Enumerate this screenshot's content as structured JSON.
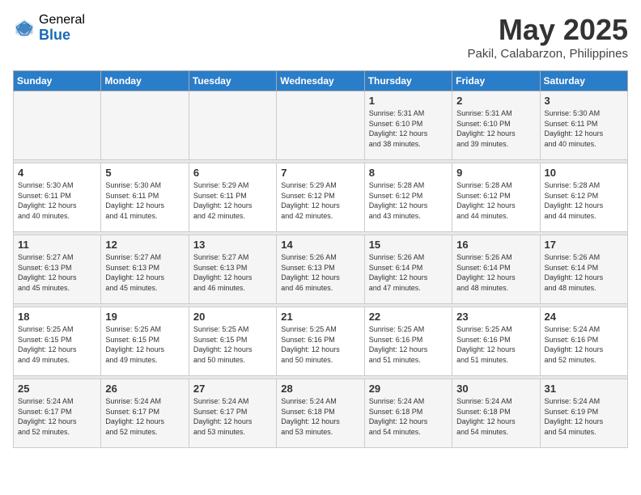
{
  "logo": {
    "general": "General",
    "blue": "Blue"
  },
  "title": "May 2025",
  "location": "Pakil, Calabarzon, Philippines",
  "days_of_week": [
    "Sunday",
    "Monday",
    "Tuesday",
    "Wednesday",
    "Thursday",
    "Friday",
    "Saturday"
  ],
  "weeks": [
    [
      {
        "day": "",
        "info": ""
      },
      {
        "day": "",
        "info": ""
      },
      {
        "day": "",
        "info": ""
      },
      {
        "day": "",
        "info": ""
      },
      {
        "day": "1",
        "info": "Sunrise: 5:31 AM\nSunset: 6:10 PM\nDaylight: 12 hours\nand 38 minutes."
      },
      {
        "day": "2",
        "info": "Sunrise: 5:31 AM\nSunset: 6:10 PM\nDaylight: 12 hours\nand 39 minutes."
      },
      {
        "day": "3",
        "info": "Sunrise: 5:30 AM\nSunset: 6:11 PM\nDaylight: 12 hours\nand 40 minutes."
      }
    ],
    [
      {
        "day": "4",
        "info": "Sunrise: 5:30 AM\nSunset: 6:11 PM\nDaylight: 12 hours\nand 40 minutes."
      },
      {
        "day": "5",
        "info": "Sunrise: 5:30 AM\nSunset: 6:11 PM\nDaylight: 12 hours\nand 41 minutes."
      },
      {
        "day": "6",
        "info": "Sunrise: 5:29 AM\nSunset: 6:11 PM\nDaylight: 12 hours\nand 42 minutes."
      },
      {
        "day": "7",
        "info": "Sunrise: 5:29 AM\nSunset: 6:12 PM\nDaylight: 12 hours\nand 42 minutes."
      },
      {
        "day": "8",
        "info": "Sunrise: 5:28 AM\nSunset: 6:12 PM\nDaylight: 12 hours\nand 43 minutes."
      },
      {
        "day": "9",
        "info": "Sunrise: 5:28 AM\nSunset: 6:12 PM\nDaylight: 12 hours\nand 44 minutes."
      },
      {
        "day": "10",
        "info": "Sunrise: 5:28 AM\nSunset: 6:12 PM\nDaylight: 12 hours\nand 44 minutes."
      }
    ],
    [
      {
        "day": "11",
        "info": "Sunrise: 5:27 AM\nSunset: 6:13 PM\nDaylight: 12 hours\nand 45 minutes."
      },
      {
        "day": "12",
        "info": "Sunrise: 5:27 AM\nSunset: 6:13 PM\nDaylight: 12 hours\nand 45 minutes."
      },
      {
        "day": "13",
        "info": "Sunrise: 5:27 AM\nSunset: 6:13 PM\nDaylight: 12 hours\nand 46 minutes."
      },
      {
        "day": "14",
        "info": "Sunrise: 5:26 AM\nSunset: 6:13 PM\nDaylight: 12 hours\nand 46 minutes."
      },
      {
        "day": "15",
        "info": "Sunrise: 5:26 AM\nSunset: 6:14 PM\nDaylight: 12 hours\nand 47 minutes."
      },
      {
        "day": "16",
        "info": "Sunrise: 5:26 AM\nSunset: 6:14 PM\nDaylight: 12 hours\nand 48 minutes."
      },
      {
        "day": "17",
        "info": "Sunrise: 5:26 AM\nSunset: 6:14 PM\nDaylight: 12 hours\nand 48 minutes."
      }
    ],
    [
      {
        "day": "18",
        "info": "Sunrise: 5:25 AM\nSunset: 6:15 PM\nDaylight: 12 hours\nand 49 minutes."
      },
      {
        "day": "19",
        "info": "Sunrise: 5:25 AM\nSunset: 6:15 PM\nDaylight: 12 hours\nand 49 minutes."
      },
      {
        "day": "20",
        "info": "Sunrise: 5:25 AM\nSunset: 6:15 PM\nDaylight: 12 hours\nand 50 minutes."
      },
      {
        "day": "21",
        "info": "Sunrise: 5:25 AM\nSunset: 6:16 PM\nDaylight: 12 hours\nand 50 minutes."
      },
      {
        "day": "22",
        "info": "Sunrise: 5:25 AM\nSunset: 6:16 PM\nDaylight: 12 hours\nand 51 minutes."
      },
      {
        "day": "23",
        "info": "Sunrise: 5:25 AM\nSunset: 6:16 PM\nDaylight: 12 hours\nand 51 minutes."
      },
      {
        "day": "24",
        "info": "Sunrise: 5:24 AM\nSunset: 6:16 PM\nDaylight: 12 hours\nand 52 minutes."
      }
    ],
    [
      {
        "day": "25",
        "info": "Sunrise: 5:24 AM\nSunset: 6:17 PM\nDaylight: 12 hours\nand 52 minutes."
      },
      {
        "day": "26",
        "info": "Sunrise: 5:24 AM\nSunset: 6:17 PM\nDaylight: 12 hours\nand 52 minutes."
      },
      {
        "day": "27",
        "info": "Sunrise: 5:24 AM\nSunset: 6:17 PM\nDaylight: 12 hours\nand 53 minutes."
      },
      {
        "day": "28",
        "info": "Sunrise: 5:24 AM\nSunset: 6:18 PM\nDaylight: 12 hours\nand 53 minutes."
      },
      {
        "day": "29",
        "info": "Sunrise: 5:24 AM\nSunset: 6:18 PM\nDaylight: 12 hours\nand 54 minutes."
      },
      {
        "day": "30",
        "info": "Sunrise: 5:24 AM\nSunset: 6:18 PM\nDaylight: 12 hours\nand 54 minutes."
      },
      {
        "day": "31",
        "info": "Sunrise: 5:24 AM\nSunset: 6:19 PM\nDaylight: 12 hours\nand 54 minutes."
      }
    ]
  ]
}
